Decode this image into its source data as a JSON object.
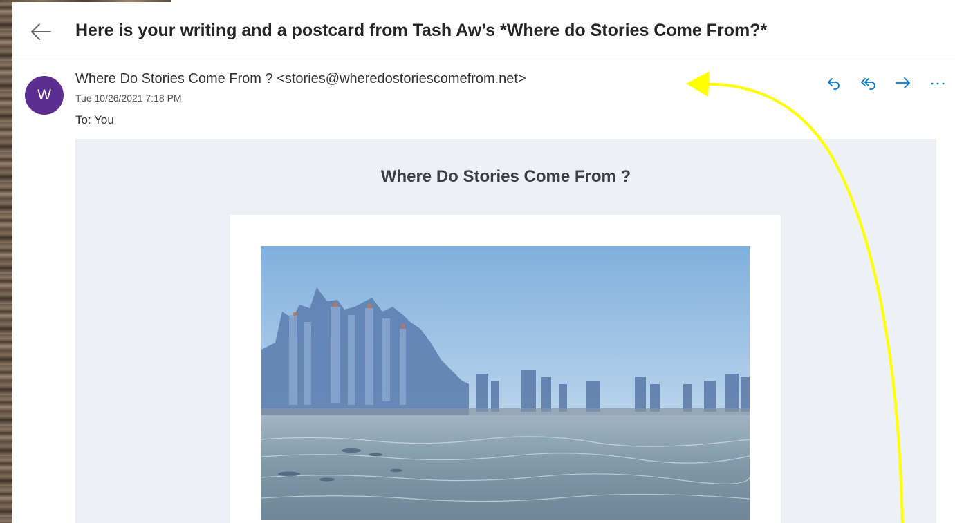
{
  "email": {
    "subject": "Here is your writing and a postcard from Tash Aw’s *Where do Stories Come From?*",
    "avatar_initial": "W",
    "sender": "Where Do Stories Come From ? <stories@wheredostoriescomefrom.net>",
    "date": "Tue 10/26/2021 7:18 PM",
    "to_line": "To: You"
  },
  "actions": [
    {
      "icon": "reply-icon"
    },
    {
      "icon": "reply-all-icon"
    },
    {
      "icon": "forward-icon"
    },
    {
      "icon": "more-options-icon"
    }
  ],
  "body": {
    "newsletter_title": "Where Do Stories Come From ?",
    "image": "postcard-cityscape-over-sea"
  },
  "colors": {
    "accent": "#0078d4",
    "avatar": "#5c2e91",
    "body_panel": "#edf1f5",
    "annotation_arrow": "#ffff00"
  }
}
